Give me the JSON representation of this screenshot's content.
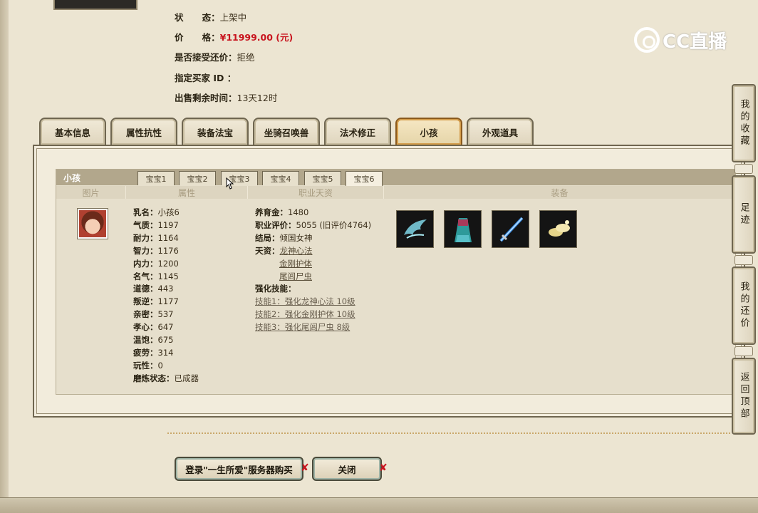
{
  "info": {
    "status_label": "状      态：",
    "status_value": "上架中",
    "price_label": "价      格：",
    "price_value": "¥11999.00 (元)",
    "bargain_label": "是否接受还价：",
    "bargain_value": "拒绝",
    "buyer_label": "指定买家 ID ：",
    "time_label": "出售剩余时间：",
    "time_value": "13天12时"
  },
  "logo": {
    "text": "CC直播"
  },
  "tabs": [
    {
      "label": "基本信息"
    },
    {
      "label": "属性抗性"
    },
    {
      "label": "装备法宝"
    },
    {
      "label": "坐骑召唤兽"
    },
    {
      "label": "法术修正"
    },
    {
      "label": "小孩"
    },
    {
      "label": "外观道具"
    }
  ],
  "child_panel": {
    "title": "小孩",
    "baby_tabs": [
      "宝宝1",
      "宝宝2",
      "宝宝3",
      "宝宝4",
      "宝宝5",
      "宝宝6"
    ],
    "columns": [
      "图片",
      "属性",
      "职业天资",
      "装备"
    ],
    "attributes": [
      {
        "label": "乳名：",
        "value": "小孩6"
      },
      {
        "label": "气质：",
        "value": "1197"
      },
      {
        "label": "耐力：",
        "value": "1164"
      },
      {
        "label": "智力：",
        "value": "1176"
      },
      {
        "label": "内力：",
        "value": "1200"
      },
      {
        "label": "名气：",
        "value": "1145"
      },
      {
        "label": "道德：",
        "value": "443"
      },
      {
        "label": "叛逆：",
        "value": "1177"
      },
      {
        "label": "亲密：",
        "value": "537"
      },
      {
        "label": "孝心：",
        "value": "647"
      },
      {
        "label": "温饱：",
        "value": "675"
      },
      {
        "label": "疲劳：",
        "value": "314"
      },
      {
        "label": "玩性：",
        "value": "0"
      },
      {
        "label": "磨炼状态：",
        "value": "已成器"
      }
    ],
    "career": {
      "fee_label": "养育金：",
      "fee_value": "1480",
      "rating_label": "职业评价：",
      "rating_value": "5055 (旧评价4764)",
      "ending_label": "结局：",
      "ending_value": "倾国女神",
      "talent_label": "天资：",
      "talents": [
        "龙神心法",
        "金刚护体",
        "尾闾尸虫"
      ],
      "skill_label": "强化技能：",
      "skills": [
        "技能1：强化龙神心法 10级",
        "技能2：强化金刚护体 10级",
        "技能3：强化尾闾尸虫 8级"
      ]
    }
  },
  "buttons": {
    "login": "登录\"一生所爱\"服务器购买",
    "close": "关闭"
  },
  "sidebar": [
    {
      "label": "我的收藏"
    },
    {
      "label": "足迹"
    },
    {
      "label": "我的还价"
    },
    {
      "label": "返回顶部"
    }
  ],
  "icons": {
    "equip1": "wing-icon",
    "equip2": "robe-icon",
    "equip3": "sword-icon",
    "equip4": "shoes-icon"
  }
}
